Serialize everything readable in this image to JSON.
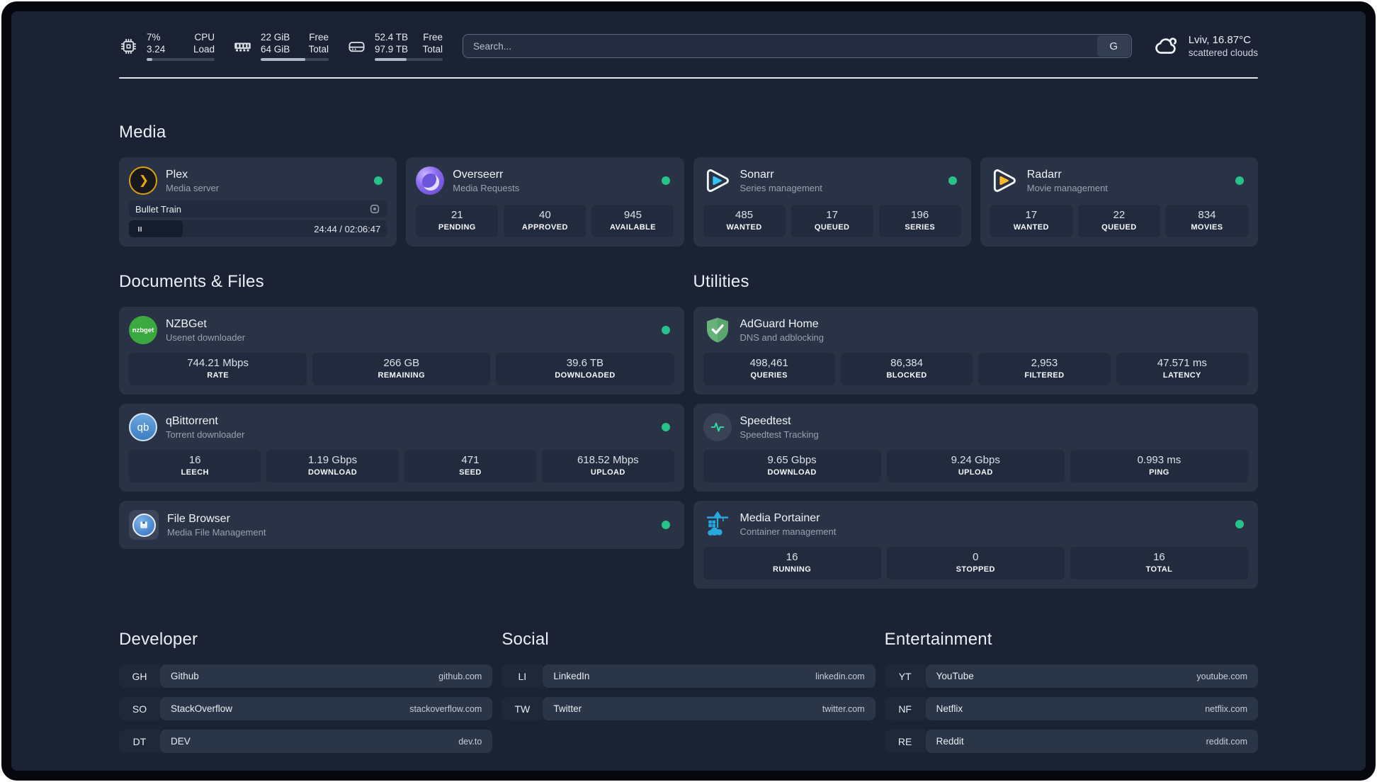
{
  "colors": {
    "status_online": "#27c28a",
    "plex_accent": "#e8a70f",
    "sonarr_accent": "#35c5f5",
    "radarr_accent": "#ffb829",
    "adguard_accent": "#67b279",
    "portainer_accent": "#29a8e0"
  },
  "topbar": {
    "stats": [
      {
        "name": "cpu",
        "value1": "7%",
        "value2": "3.24",
        "label1": "CPU",
        "label2": "Load",
        "progress": 8
      },
      {
        "name": "ram",
        "value1": "22 GiB",
        "value2": "64 GiB",
        "label1": "Free",
        "label2": "Total",
        "progress": 66
      },
      {
        "name": "disk",
        "value1": "52.4 TB",
        "value2": "97.9 TB",
        "label1": "Free",
        "label2": "Total",
        "progress": 47
      }
    ],
    "search": {
      "placeholder": "Search...",
      "button_label": "G"
    },
    "weather": {
      "location": "Lviv, 16.87°C",
      "condition": "scattered clouds"
    }
  },
  "media": {
    "title": "Media",
    "plex": {
      "title": "Plex",
      "subtitle": "Media server",
      "session": {
        "media_title": "Bullet Train",
        "time_display": "24:44 / 02:06:47",
        "progress": 21
      }
    },
    "overseerr": {
      "title": "Overseerr",
      "subtitle": "Media Requests",
      "stats": [
        {
          "value": "21",
          "label": "PENDING"
        },
        {
          "value": "40",
          "label": "APPROVED"
        },
        {
          "value": "945",
          "label": "AVAILABLE"
        }
      ]
    },
    "sonarr": {
      "title": "Sonarr",
      "subtitle": "Series management",
      "stats": [
        {
          "value": "485",
          "label": "WANTED"
        },
        {
          "value": "17",
          "label": "QUEUED"
        },
        {
          "value": "196",
          "label": "SERIES"
        }
      ]
    },
    "radarr": {
      "title": "Radarr",
      "subtitle": "Movie management",
      "stats": [
        {
          "value": "17",
          "label": "WANTED"
        },
        {
          "value": "22",
          "label": "QUEUED"
        },
        {
          "value": "834",
          "label": "MOVIES"
        }
      ]
    }
  },
  "documents": {
    "title": "Documents & Files",
    "nzbget": {
      "title": "NZBGet",
      "subtitle": "Usenet downloader",
      "icon_text": "nzbget",
      "stats": [
        {
          "value": "744.21 Mbps",
          "label": "RATE"
        },
        {
          "value": "266 GB",
          "label": "REMAINING"
        },
        {
          "value": "39.6 TB",
          "label": "DOWNLOADED"
        }
      ]
    },
    "qbittorrent": {
      "title": "qBittorrent",
      "subtitle": "Torrent downloader",
      "icon_text": "qb",
      "stats": [
        {
          "value": "16",
          "label": "LEECH"
        },
        {
          "value": "1.19 Gbps",
          "label": "DOWNLOAD"
        },
        {
          "value": "471",
          "label": "SEED"
        },
        {
          "value": "618.52 Mbps",
          "label": "UPLOAD"
        }
      ]
    },
    "filebrowser": {
      "title": "File Browser",
      "subtitle": "Media File Management"
    }
  },
  "utilities": {
    "title": "Utilities",
    "adguard": {
      "title": "AdGuard Home",
      "subtitle": "DNS and adblocking",
      "stats": [
        {
          "value": "498,461",
          "label": "QUERIES"
        },
        {
          "value": "86,384",
          "label": "BLOCKED"
        },
        {
          "value": "2,953",
          "label": "FILTERED"
        },
        {
          "value": "47.571 ms",
          "label": "LATENCY"
        }
      ]
    },
    "speedtest": {
      "title": "Speedtest",
      "subtitle": "Speedtest Tracking",
      "stats": [
        {
          "value": "9.65 Gbps",
          "label": "DOWNLOAD"
        },
        {
          "value": "9.24 Gbps",
          "label": "UPLOAD"
        },
        {
          "value": "0.993 ms",
          "label": "PING"
        }
      ]
    },
    "portainer": {
      "title": "Media Portainer",
      "subtitle": "Container management",
      "stats": [
        {
          "value": "16",
          "label": "RUNNING"
        },
        {
          "value": "0",
          "label": "STOPPED"
        },
        {
          "value": "16",
          "label": "TOTAL"
        }
      ]
    }
  },
  "bookmarks": {
    "developer": {
      "title": "Developer",
      "links": [
        {
          "abbr": "GH",
          "name": "Github",
          "url": "github.com"
        },
        {
          "abbr": "SO",
          "name": "StackOverflow",
          "url": "stackoverflow.com"
        },
        {
          "abbr": "DT",
          "name": "DEV",
          "url": "dev.to"
        }
      ]
    },
    "social": {
      "title": "Social",
      "links": [
        {
          "abbr": "LI",
          "name": "LinkedIn",
          "url": "linkedin.com"
        },
        {
          "abbr": "TW",
          "name": "Twitter",
          "url": "twitter.com"
        }
      ]
    },
    "entertainment": {
      "title": "Entertainment",
      "links": [
        {
          "abbr": "YT",
          "name": "YouTube",
          "url": "youtube.com"
        },
        {
          "abbr": "NF",
          "name": "Netflix",
          "url": "netflix.com"
        },
        {
          "abbr": "RE",
          "name": "Reddit",
          "url": "reddit.com"
        }
      ]
    }
  }
}
